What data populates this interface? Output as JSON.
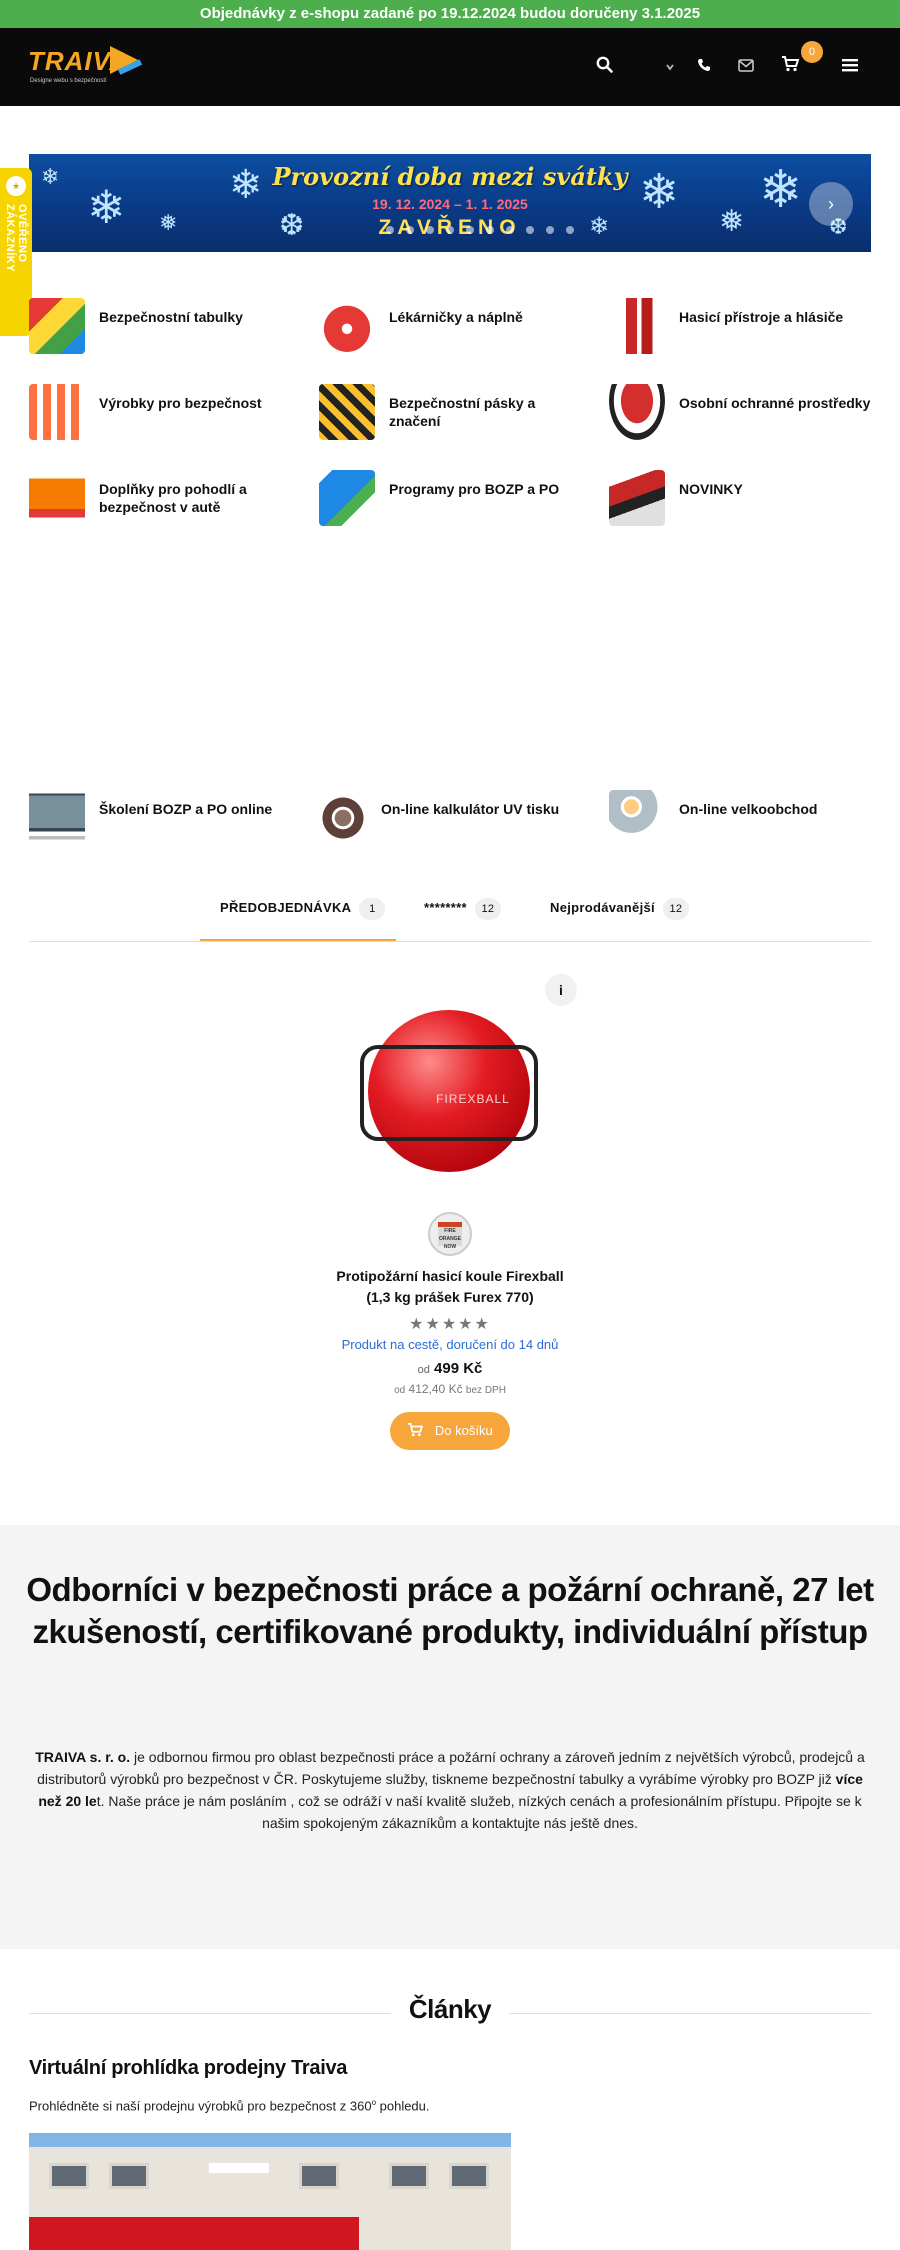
{
  "announcement": "Objednávky z e-shopu zadané po 19.12.2024 budou doručeny 3.1.2025",
  "header": {
    "logo_text": "TRAIVA",
    "logo_sub": "Designe webu s bezpečností",
    "cart_count": "0",
    "icons": [
      "search-icon",
      "chevron-down-icon",
      "phone-icon",
      "mail-icon",
      "cart-icon",
      "menu-icon"
    ]
  },
  "sidetab": {
    "label": "OVĚŘENO ZÁKAZNÍKY",
    "badge": "★"
  },
  "banner": {
    "title": "Provozní doba mezi svátky",
    "dates": "19. 12. 2024 – 1. 1. 2025",
    "status": "ZAVŘENO",
    "next": "›"
  },
  "categories": [
    {
      "label": "Bezpečnostní tabulky",
      "color": "#e53935"
    },
    {
      "label": "Lékárničky a náplně",
      "color": "#e53935"
    },
    {
      "label": "Hasicí přístroje a hlásiče",
      "color": "#c62828"
    },
    {
      "label": "Výrobky pro bezpečnost",
      "color": "#ff7043"
    },
    {
      "label": "Bezpečnostní pásky a značení",
      "color": "#fbc02d"
    },
    {
      "label": "Osobní ochranné prostředky",
      "color": "#d32f2f"
    },
    {
      "label": "Doplňky pro pohodlí a bezpečnost v autě",
      "color": "#f57c00"
    },
    {
      "label": "Programy pro BOZP a PO",
      "color": "#1e88e5"
    },
    {
      "label": "NOVINKY",
      "color": "#c62828"
    },
    {
      "label": "Školení BOZP a PO online",
      "color": "#546e7a"
    },
    {
      "label": "On-line kalkulátor UV tisku",
      "color": "#8d6e63"
    },
    {
      "label": "On-line velkoobchod",
      "color": "#ffcc80"
    }
  ],
  "tabs": [
    {
      "label": "PŘEDOBJEDNÁVKA",
      "count": "1"
    },
    {
      "label": "********",
      "count": "12"
    },
    {
      "label": "Nejprodávanější",
      "count": "12"
    }
  ],
  "product": {
    "info": "i",
    "image_text": "FIREXBALL",
    "brand_text": "FIRE ORANGE NOW",
    "name_line1": "Protipožární hasicí koule Firexball",
    "name_line2": "(1,3 kg prášek Furex 770)",
    "stars": "★★★★★",
    "availability": "Produkt na cestě, doručení do 14 dnů",
    "price_prefix": "od",
    "price": "499 Kč",
    "price2_prefix": "od",
    "price2": "412,40 Kč",
    "price2_suffix": "bez DPH",
    "cart_label": "Do košíku"
  },
  "about": {
    "title": "Odborníci v bezpečnosti práce a požární ochraně, 27 let zkušeností, certifikované produkty, individuální přístup",
    "company": "TRAIVA s. r. o.",
    "text1": " je odbornou firmou pro oblast bezpečnosti práce a požární ochrany a zároveň jedním z největších výrobců, prodejců a distributorů výrobků pro bezpečnost v ČR. Poskytujeme služby, tiskneme bezpečnostní tabulky a vyrábíme výrobky pro BOZP již ",
    "years": "více než 20 le",
    "text2": "t. Naše práce je nám posláním , což se odráží v naší kvalitě služeb, nízkých cenách a profesionálním přístupu. Připojte se k našim spokojeným zákazníkům a kontaktujte nás ještě dnes."
  },
  "articles": {
    "heading": "Články",
    "item_title": "Virtuální prohlídka prodejny Traiva",
    "item_desc": "Prohlédněte si naší prodejnu výrobků pro bezpečnost z 360",
    "item_desc_sup": "o",
    "item_desc_end": " pohledu."
  }
}
